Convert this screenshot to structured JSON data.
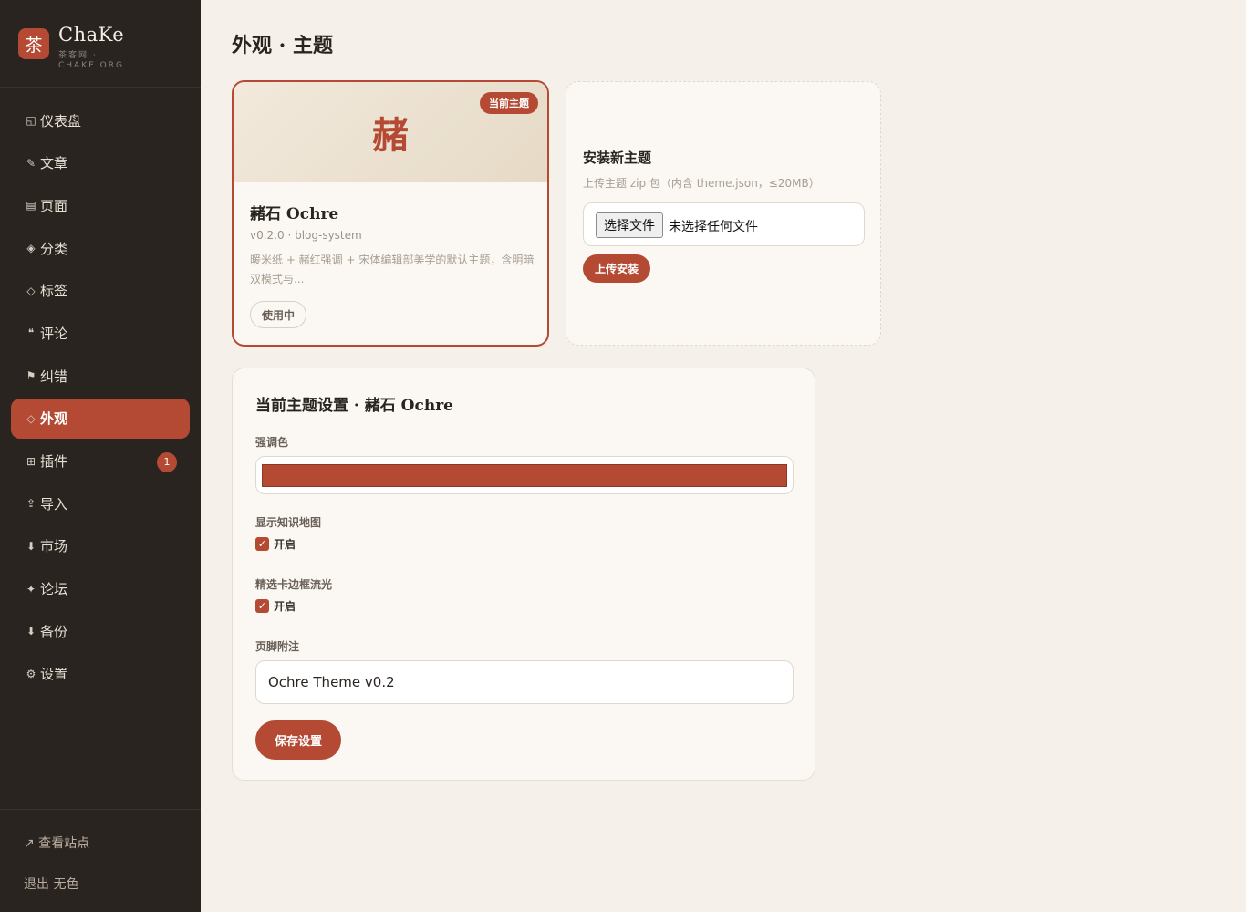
{
  "brand": {
    "logo_char": "茶",
    "name": "ChaKe",
    "subtitle": "茶客网 · CHAKE.ORG"
  },
  "nav": [
    {
      "icon": "◱",
      "label": "仪表盘"
    },
    {
      "icon": "✎",
      "label": "文章"
    },
    {
      "icon": "▤",
      "label": "页面"
    },
    {
      "icon": "◈",
      "label": "分类"
    },
    {
      "icon": "◇",
      "label": "标签"
    },
    {
      "icon": "❝",
      "label": "评论"
    },
    {
      "icon": "⚑",
      "label": "纠错"
    },
    {
      "icon": "◇",
      "label": "外观",
      "active": true
    },
    {
      "icon": "⊞",
      "label": "插件",
      "badge": "1"
    },
    {
      "icon": "⇪",
      "label": "导入"
    },
    {
      "icon": "⬇",
      "label": "市场"
    },
    {
      "icon": "✦",
      "label": "论坛"
    },
    {
      "icon": "⬇",
      "label": "备份"
    },
    {
      "icon": "⚙",
      "label": "设置"
    }
  ],
  "footer": {
    "view_site": "↗ 查看站点",
    "logout": "退出 无色"
  },
  "page": {
    "title": "外观 · 主题"
  },
  "current_theme": {
    "badge": "当前主题",
    "preview_glyph": "赭",
    "name": "赭石 Ochre",
    "meta": "v0.2.0 · blog-system",
    "description": "暖米纸 + 赭红强调 + 宋体编辑部美学的默认主题，含明暗双模式与...",
    "status_button": "使用中"
  },
  "install": {
    "title": "安装新主题",
    "hint": "上传主题 zip 包（内含 theme.json，≤20MB）",
    "choose_file": "选择文件",
    "no_file": "未选择任何文件",
    "upload_button": "上传安装"
  },
  "settings": {
    "title": "当前主题设置 · 赭石 Ochre",
    "accent_label": "强调色",
    "accent_color": "#b44a34",
    "knowledge_map_label": "显示知识地图",
    "knowledge_map_option": "开启",
    "knowledge_map_checked": true,
    "border_glow_label": "精选卡边框流光",
    "border_glow_option": "开启",
    "border_glow_checked": true,
    "footer_note_label": "页脚附注",
    "footer_note_value": "Ochre Theme v0.2",
    "save_button": "保存设置"
  }
}
